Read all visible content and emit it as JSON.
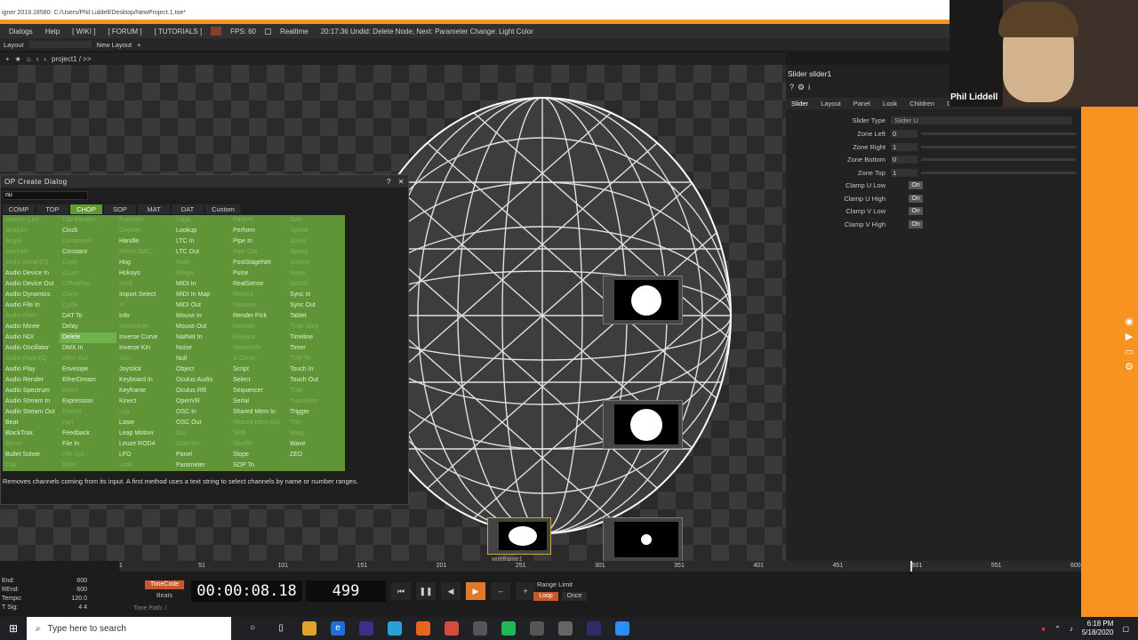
{
  "window": {
    "title": "igner 2019.18580: C:/Users/Phil Liddell/Desktop/NewProject.1.toe*"
  },
  "menubar": {
    "items": [
      "Dialogs",
      "Help",
      "[ WIKI ]",
      "[ FORUM ]",
      "[ TUTORIALS ]"
    ],
    "fps_label": "FPS: 60",
    "realtime_label": "Realtime",
    "status_message": "20:17:36 Undid: Delete Node; Next: Parameter Change: Light Color"
  },
  "layoutbar": {
    "layout_label": "Layout",
    "new_layout_label": "New Layout"
  },
  "pathbar": {
    "path": "project1 / >>"
  },
  "op_create_dialog": {
    "title": "OP Create Dialog",
    "search_value": "nu",
    "tabs": [
      "COMP",
      "TOP",
      "CHOP",
      "SOP",
      "MAT",
      "DAT",
      "Custom"
    ],
    "active_tab": "CHOP",
    "columns": [
      [
        "Ableton Link",
        "Analyze",
        "Angle",
        "Attribute",
        "Audio Band EQ",
        "Audio Device In",
        "Audio Device Out",
        "Audio Dynamics",
        "Audio File In",
        "Audio Filter",
        "Audio Movie",
        "Audio NDI",
        "Audio Oscillator",
        "Audio Para EQ",
        "Audio Play",
        "Audio Render",
        "Audio Spectrum",
        "Audio Stream In",
        "Audio Stream Out",
        "Beat",
        "BlackTrax",
        "Blend",
        "Bullet Solver",
        "Clip"
      ],
      [
        "Clip Blender",
        "Clock",
        "Composite",
        "Constant",
        "Copy",
        "Count",
        "CPlusPlus",
        "Cross",
        "Cycle",
        "DAT To",
        "Delay",
        "Delete",
        "DMX In",
        "DMX Out",
        "Envelope",
        "EtherDream",
        "Event",
        "Expression",
        "Extend",
        "Fan",
        "Feedback",
        "File In",
        "File Out",
        "Filter"
      ],
      [
        "Function",
        "Gesture",
        "Handle",
        "Helios DAC",
        "Hog",
        "Hokuyo",
        "Hold",
        "Import Select",
        "In",
        "Info",
        "Interpolate",
        "Inverse Curve",
        "Inverse Kin",
        "Join",
        "Joystick",
        "Keyboard In",
        "Keyframe",
        "Kinect",
        "Lag",
        "Laser",
        "Leap Motion",
        "Leuze ROD4",
        "LFO",
        "Limit"
      ],
      [
        "Logic",
        "Lookup",
        "LTC In",
        "LTC Out",
        "Math",
        "Merge",
        "MIDI In",
        "MIDI In Map",
        "MIDI Out",
        "Mouse In",
        "Mouse Out",
        "NatNet In",
        "Noise",
        "Null",
        "Object",
        "Oculus Audio",
        "Oculus Rift",
        "OpenVR",
        "OSC In",
        "OSC Out",
        "Out",
        "Override",
        "Panel",
        "Parameter"
      ],
      [
        "Pattern",
        "Perform",
        "Pipe In",
        "Pipe Out",
        "PosiStageNet",
        "Pulse",
        "RealSense",
        "Record",
        "Rename",
        "Render Pick",
        "Reorder",
        "Replace",
        "Resample",
        "S Curve",
        "Script",
        "Select",
        "Sequencer",
        "Serial",
        "Shared Mem In",
        "Shared Mem Out",
        "Shift",
        "Shuffle",
        "Slope",
        "SOP To"
      ],
      [
        "Sort",
        "Speed",
        "Splice",
        "Spring",
        "Stretch",
        "Stype",
        "Switch",
        "Sync In",
        "Sync Out",
        "Tablet",
        "Time Slice",
        "Timeline",
        "Timer",
        "TOP To",
        "Touch In",
        "Touch Out",
        "Trail",
        "Transform",
        "Trigger",
        "Trim",
        "Warp",
        "Wave",
        "ZED",
        ""
      ]
    ],
    "description": "Removes channels coming from its input. A first method uses a text string to select channels by name or number ranges."
  },
  "parameters": {
    "title": "Slider  slider1",
    "tabs": [
      "Slider",
      "Layout",
      "Panel",
      "Look",
      "Children",
      "Dr"
    ],
    "active_tab": "Slider",
    "slider_type_label": "Slider Type",
    "slider_type_value": "Slider U",
    "numeric": [
      {
        "label": "Zone Left",
        "value": "0"
      },
      {
        "label": "Zone Right",
        "value": "1"
      },
      {
        "label": "Zone Bottom",
        "value": "0"
      },
      {
        "label": "Zone Top",
        "value": "1"
      }
    ],
    "toggles": [
      {
        "label": "Clamp U Low",
        "value": "On"
      },
      {
        "label": "Clamp U High",
        "value": "On"
      },
      {
        "label": "Clamp V Low",
        "value": "On"
      },
      {
        "label": "Clamp V High",
        "value": "On"
      }
    ]
  },
  "webcam": {
    "name": "Phil Liddell"
  },
  "network": {
    "node_label": "wireframe1"
  },
  "timeline": {
    "ruler_ticks": [
      "1",
      "51",
      "101",
      "151",
      "201",
      "251",
      "301",
      "351",
      "401",
      "451",
      "501",
      "551",
      "600"
    ],
    "stats": [
      {
        "label": "End:",
        "value": "600"
      },
      {
        "label": "REnd:",
        "value": "600"
      },
      {
        "label": "Tempo:",
        "value": "120.0"
      },
      {
        "label": "T Sig:",
        "value": "4    4"
      }
    ],
    "timecode_button": "TimeCode",
    "beats_button": "Beats",
    "timecode": "00:00:08.18",
    "frame": "499",
    "range_limit_label": "Range Limit",
    "loop_label": "Loop",
    "once_label": "Once",
    "time_path": "Time Path: /"
  },
  "taskbar": {
    "search_placeholder": "Type here to search",
    "time": "6:18 PM",
    "date": "5/18/2020"
  },
  "colors": {
    "accent_orange": "#f7931e",
    "chop_green": "#5f9437"
  }
}
